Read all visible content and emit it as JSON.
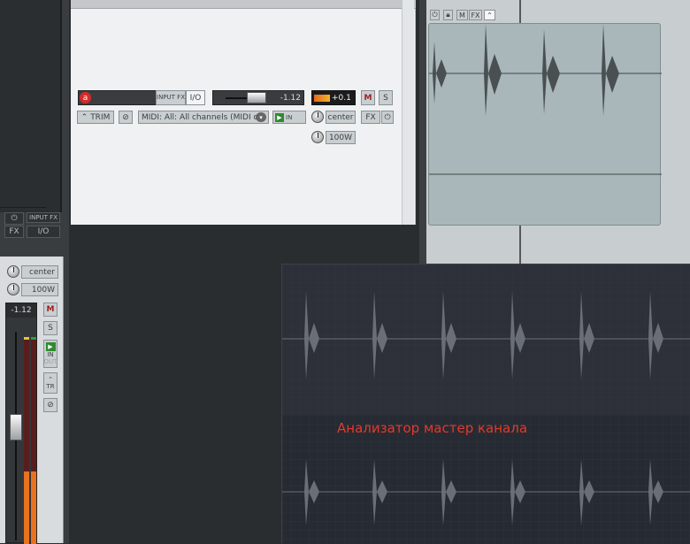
{
  "mixer_top": {
    "power_icon": "power-icon",
    "input_fx_label": "INPUT FX",
    "fx_label": "FX",
    "io_label": "I/O"
  },
  "track": {
    "record_arm_letter": "a",
    "input_fx_label": "INPUT FX",
    "io_label": "I/O",
    "volume_value": "-1.12",
    "meter_peak": "+0.1",
    "mute_label": "M",
    "solo_label": "S",
    "trim_label": "TRIM",
    "midi_input": "MIDI: All: All channels (MIDI o",
    "monitor_label": "IN",
    "pan_value": "center",
    "width_value": "100W",
    "fx_label": "FX"
  },
  "arrange": {
    "header_buttons": [
      "M",
      "FX"
    ]
  },
  "mixer_strip": {
    "pan_value": "center",
    "width_value": "100W",
    "volume_value": "-1.12",
    "mute_label": "M",
    "solo_label": "S",
    "in_label": "IN",
    "out_label": "OUT",
    "tr_label": "TR",
    "fader_level": 0.55,
    "meter_level": 0.35
  },
  "analyzer": {
    "caption": "Анализатор мастер канала",
    "caption_color": "#e23a2e"
  }
}
